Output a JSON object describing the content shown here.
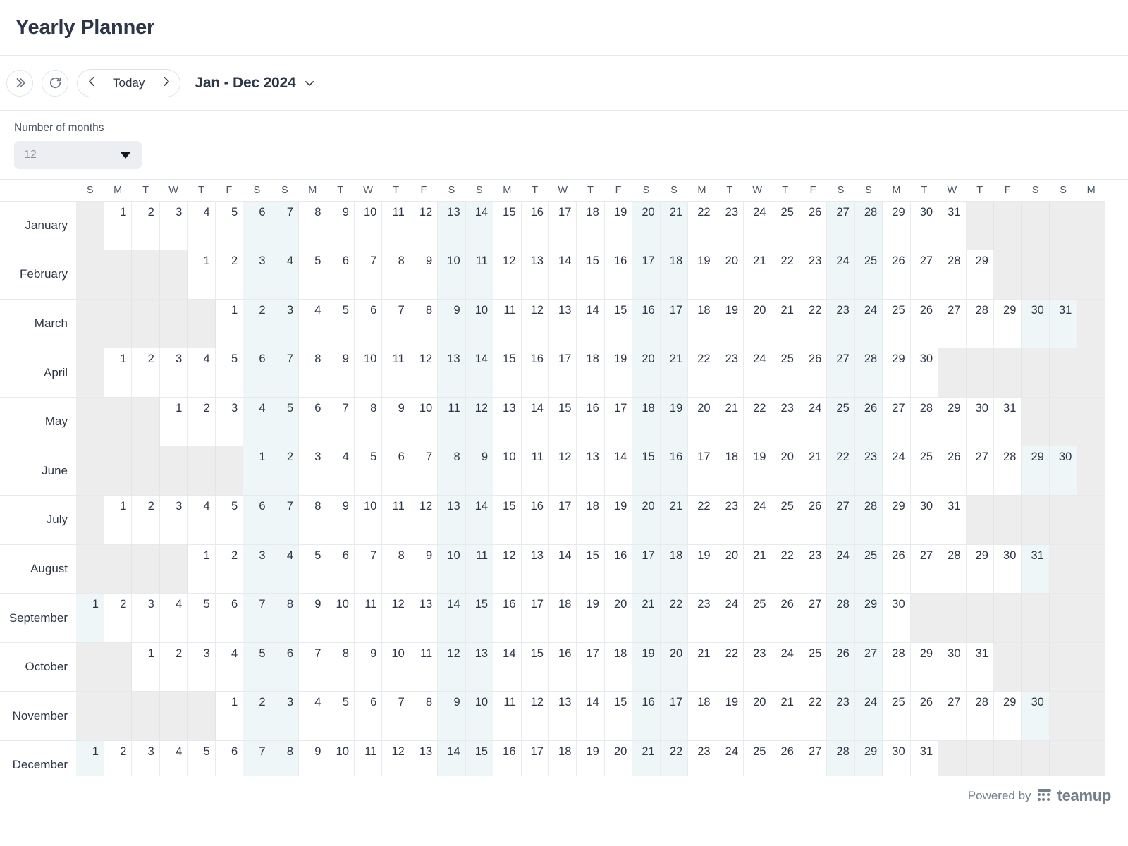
{
  "header": {
    "title": "Yearly Planner"
  },
  "toolbar": {
    "expand_icon": "double-chevron-right-icon",
    "refresh_icon": "refresh-icon",
    "prev_label": "chevron-left-icon",
    "today_label": "Today",
    "next_label": "chevron-right-icon",
    "range_label": "Jan - Dec 2024",
    "range_caret": "chevron-down-icon"
  },
  "options": {
    "months_label": "Number of months",
    "months_value": "12",
    "months_caret": "caret-down-icon"
  },
  "colors": {
    "weekend_tint": "#eef6f8",
    "blank_cell": "#ededed",
    "grid_line": "#e7e9ec",
    "text": "#2c3646"
  },
  "calendar": {
    "year": 2024,
    "columns": 37,
    "weekday_start": "S",
    "weekday_cycle": [
      "S",
      "M",
      "T",
      "W",
      "T",
      "F",
      "S"
    ],
    "months": [
      {
        "name": "January",
        "offset": 1,
        "days": 31
      },
      {
        "name": "February",
        "offset": 4,
        "days": 29
      },
      {
        "name": "March",
        "offset": 5,
        "days": 31
      },
      {
        "name": "April",
        "offset": 1,
        "days": 30
      },
      {
        "name": "May",
        "offset": 3,
        "days": 31
      },
      {
        "name": "June",
        "offset": 6,
        "days": 30
      },
      {
        "name": "July",
        "offset": 1,
        "days": 31
      },
      {
        "name": "August",
        "offset": 4,
        "days": 31
      },
      {
        "name": "September",
        "offset": 0,
        "days": 30
      },
      {
        "name": "October",
        "offset": 2,
        "days": 31
      },
      {
        "name": "November",
        "offset": 5,
        "days": 30
      },
      {
        "name": "December",
        "offset": 0,
        "days": 31
      }
    ]
  },
  "footer": {
    "powered_by": "Powered by",
    "brand": "teamup",
    "brand_icon": "teamup-dots-logo"
  }
}
